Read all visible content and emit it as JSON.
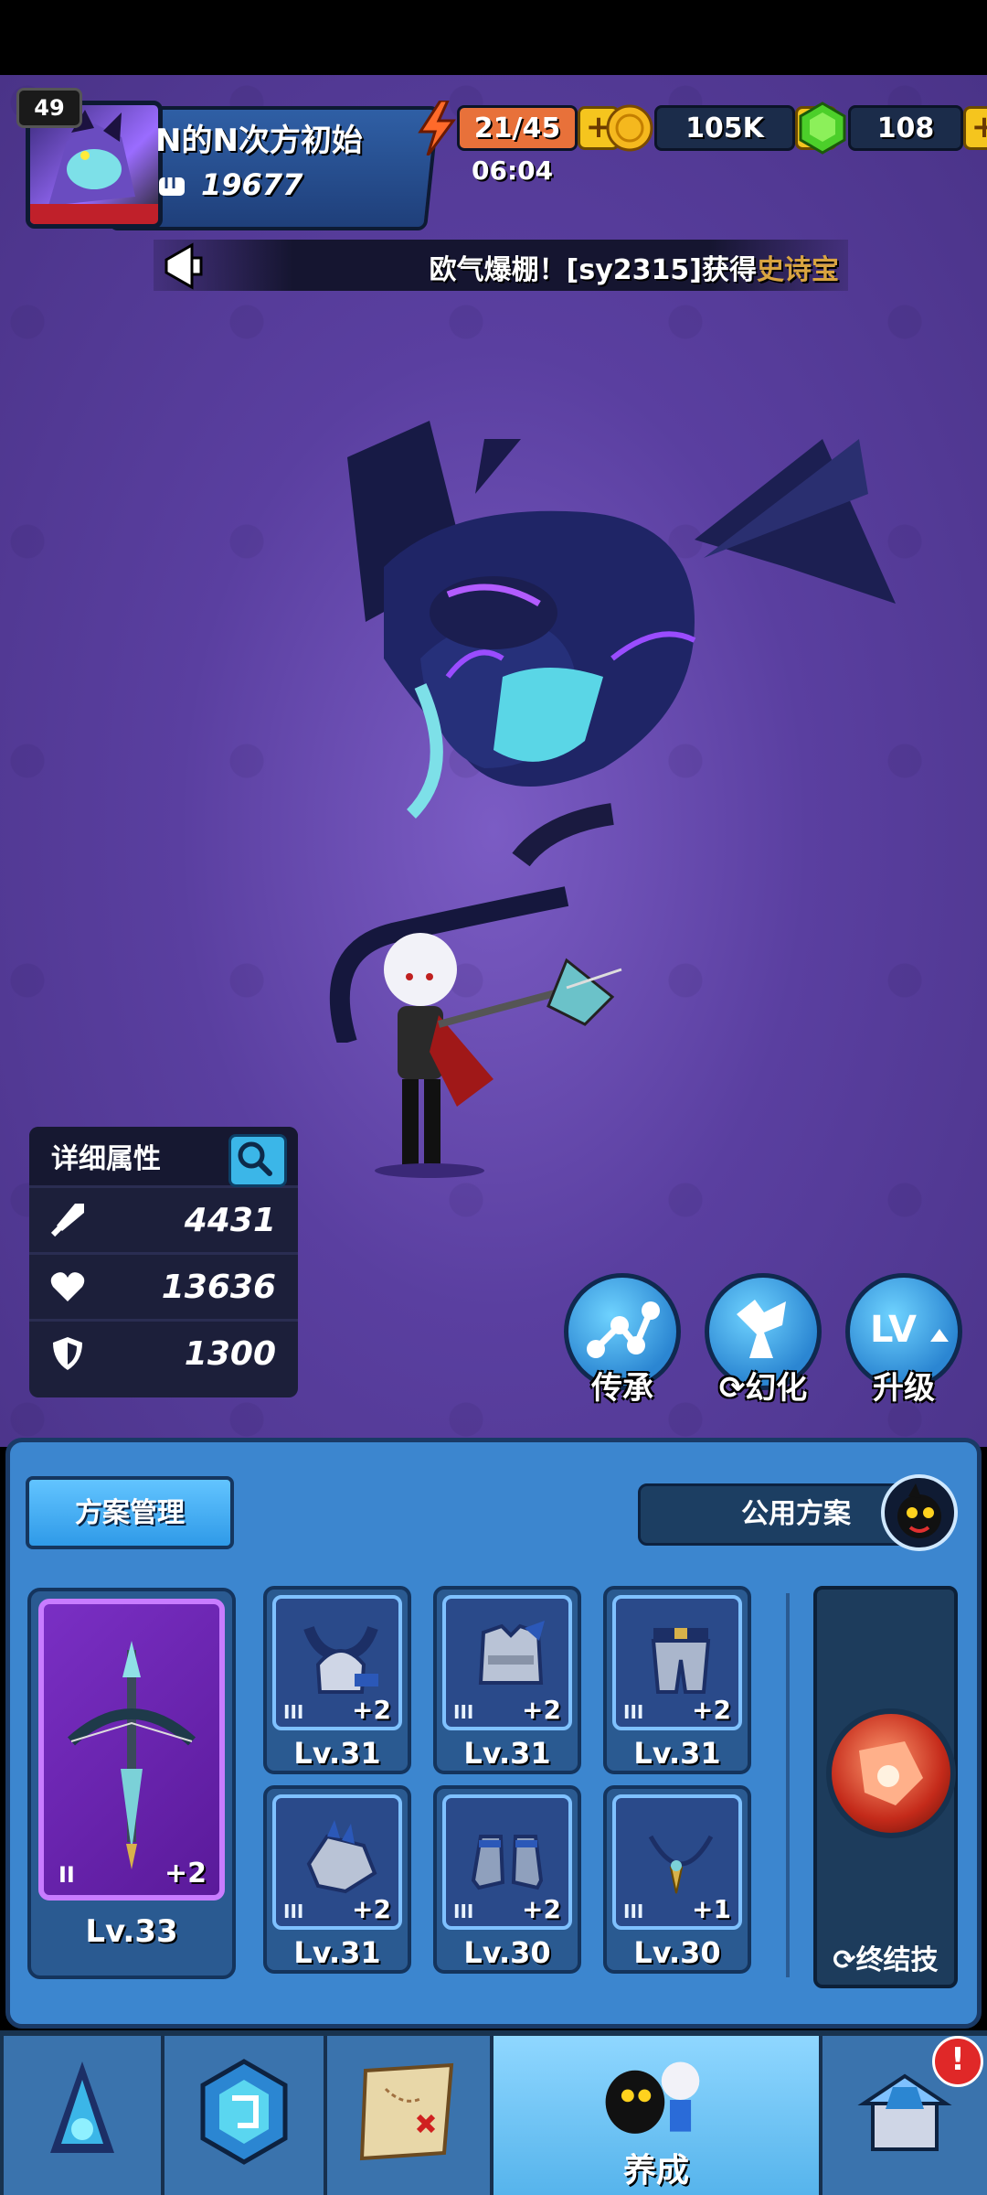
{
  "player": {
    "level": "49",
    "name": "N的N次方初始",
    "power": "19677"
  },
  "resources": {
    "energy": "21/45",
    "energy_timer": "06:04",
    "gold": "105K",
    "gems": "108",
    "plus": "+"
  },
  "ticker": {
    "message_prefix": "欧气爆棚！[sy2315]获得",
    "message_highlight": "史诗宝"
  },
  "attributes": {
    "title": "详细属性",
    "attack": "4431",
    "health": "13636",
    "defense": "1300"
  },
  "actions": {
    "inherit": "传承",
    "transform": "幻化",
    "upgrade": "升级"
  },
  "equipment": {
    "plan_button": "方案管理",
    "shared_plan": "公用方案",
    "weapon": {
      "tier": "II",
      "bonus": "+2",
      "level": "Lv.33"
    },
    "slots": [
      {
        "name": "helmet",
        "tier": "III",
        "bonus": "+2",
        "level": "Lv.31"
      },
      {
        "name": "armor",
        "tier": "III",
        "bonus": "+2",
        "level": "Lv.31"
      },
      {
        "name": "pants",
        "tier": "III",
        "bonus": "+2",
        "level": "Lv.31"
      },
      {
        "name": "gloves",
        "tier": "III",
        "bonus": "+2",
        "level": "Lv.31"
      },
      {
        "name": "boots",
        "tier": "III",
        "bonus": "+2",
        "level": "Lv.30"
      },
      {
        "name": "necklace",
        "tier": "III",
        "bonus": "+1",
        "level": "Lv.30"
      }
    ],
    "ultimate": "终结技"
  },
  "nav": {
    "active_label": "养成",
    "alert": "!"
  },
  "colors": {
    "background": "#5a3fa0",
    "panel": "#3c86cf",
    "accent_gold": "#f5c51e",
    "highlight_text": "#d9a441"
  }
}
